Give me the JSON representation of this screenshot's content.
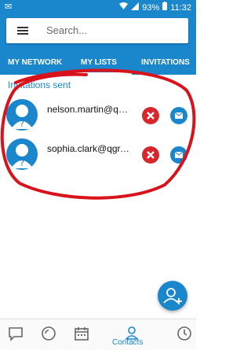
{
  "status_bar": {
    "battery": "93%",
    "time": "11:32"
  },
  "search": {
    "placeholder": "Search..."
  },
  "tabs": [
    {
      "label": "MY NETWORK"
    },
    {
      "label": "MY LISTS"
    },
    {
      "label": "INVITATIONS"
    }
  ],
  "section": {
    "title": "Invitations sent"
  },
  "invitations": [
    {
      "email": "nelson.martin@qgr..."
    },
    {
      "email": "sophia.clark@qgr.te..."
    }
  ],
  "bottom_nav": {
    "active_label": "Contacts"
  },
  "colors": {
    "brand": "#1a86cc",
    "cancel": "#d7262c",
    "annotation": "#d8131c"
  }
}
